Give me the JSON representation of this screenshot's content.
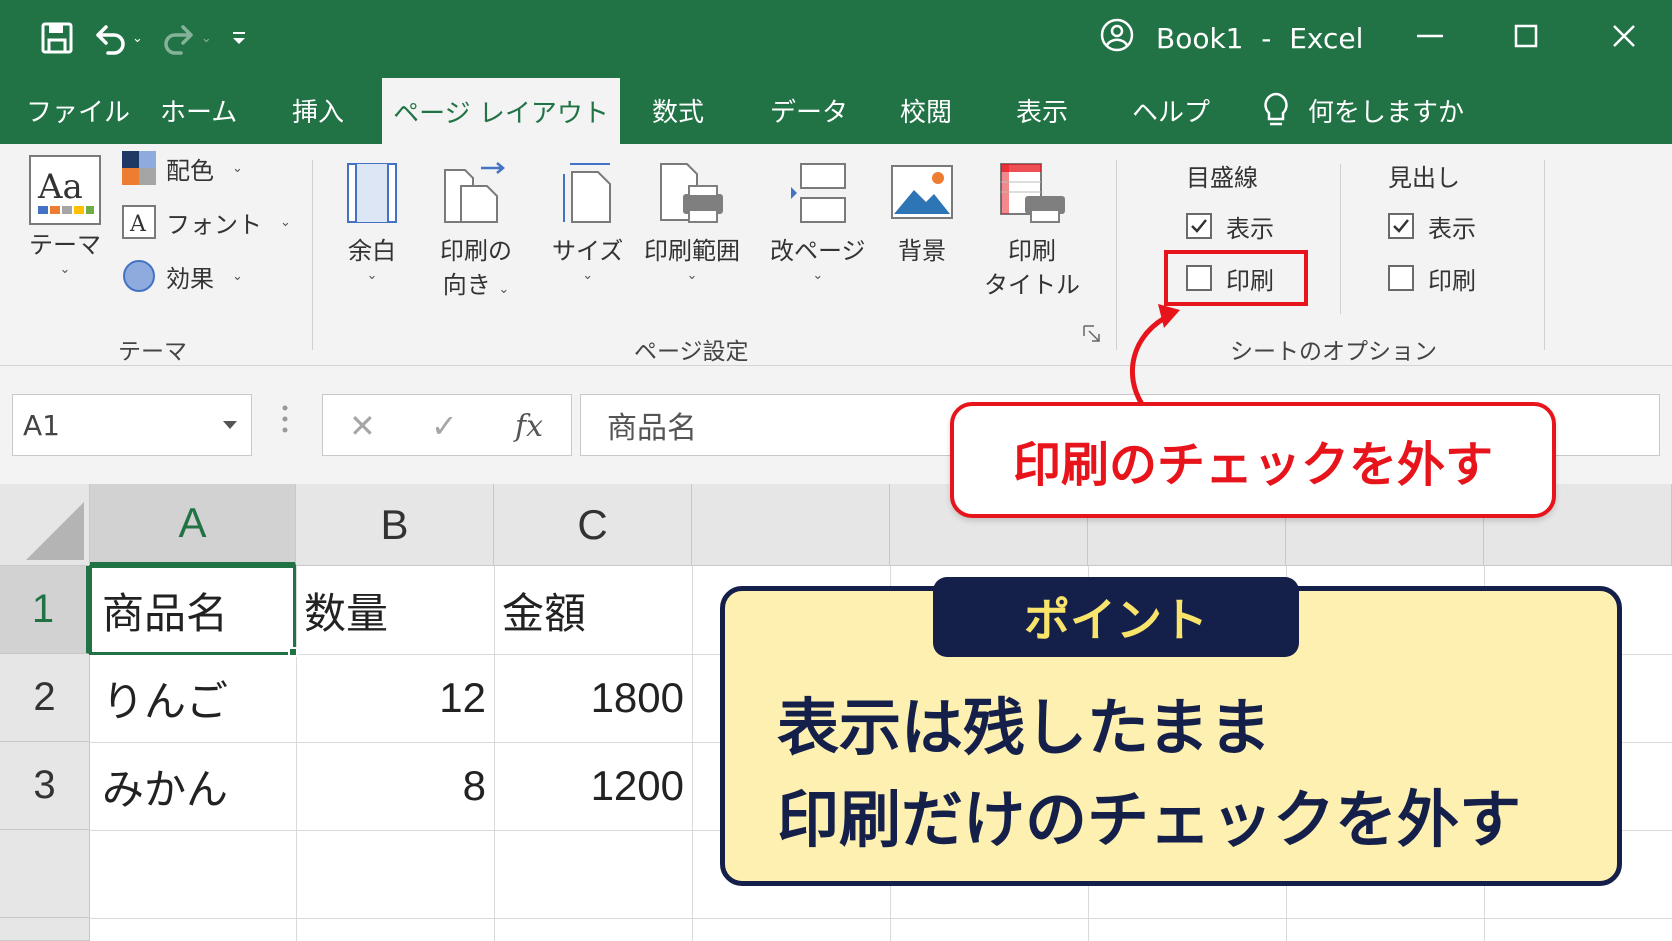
{
  "titlebar": {
    "title": "Book1  -  Excel",
    "bg_color": "#217346",
    "icons": [
      "save-icon",
      "undo-icon",
      "redo-icon",
      "customize-qat-icon",
      "account-icon",
      "minimize-icon",
      "maximize-icon",
      "close-icon"
    ]
  },
  "tabs": {
    "items": [
      "ファイル",
      "ホーム",
      "挿入",
      "ページ レイアウト",
      "数式",
      "データ",
      "校閲",
      "表示",
      "ヘルプ"
    ],
    "active": "ページ レイアウト",
    "tell_me": "何をしますか"
  },
  "ribbon": {
    "theme_group": {
      "label": "テーマ",
      "theme_button": "テーマ",
      "colors": "配色",
      "fonts": "フォント",
      "effects": "効果"
    },
    "page_setup_group": {
      "label": "ページ設定",
      "margins": "余白",
      "orientation_line1": "印刷の",
      "orientation_line2": "向き",
      "size": "サイズ",
      "print_area": "印刷範囲",
      "breaks": "改ページ",
      "background": "背景",
      "print_titles_line1": "印刷",
      "print_titles_line2": "タイトル"
    },
    "sheet_options_group": {
      "label": "シートのオプション",
      "gridlines": {
        "heading": "目盛線",
        "view_label": "表示",
        "view_checked": true,
        "print_label": "印刷",
        "print_checked": false
      },
      "headings": {
        "heading": "見出し",
        "view_label": "表示",
        "view_checked": true,
        "print_label": "印刷",
        "print_checked": false
      }
    }
  },
  "formula_bar": {
    "name_box": "A1",
    "fx": "fx",
    "content": "商品名"
  },
  "sheet": {
    "columns": [
      "A",
      "B",
      "C"
    ],
    "rows": [
      "1",
      "2",
      "3"
    ],
    "cells": [
      [
        "商品名",
        "数量",
        "金額"
      ],
      [
        "りんご",
        "12",
        "1800"
      ],
      [
        "みかん",
        "8",
        "1200"
      ]
    ],
    "active_cell": "A1"
  },
  "annotations": {
    "callout": "印刷のチェックを外す",
    "callout_color": "#e8141c",
    "point_tag": "ポイント",
    "point_line1": "表示は残したまま",
    "point_line2": "印刷だけのチェックを外す",
    "point_bg": "#fdf0b0",
    "point_border": "#14204a"
  }
}
